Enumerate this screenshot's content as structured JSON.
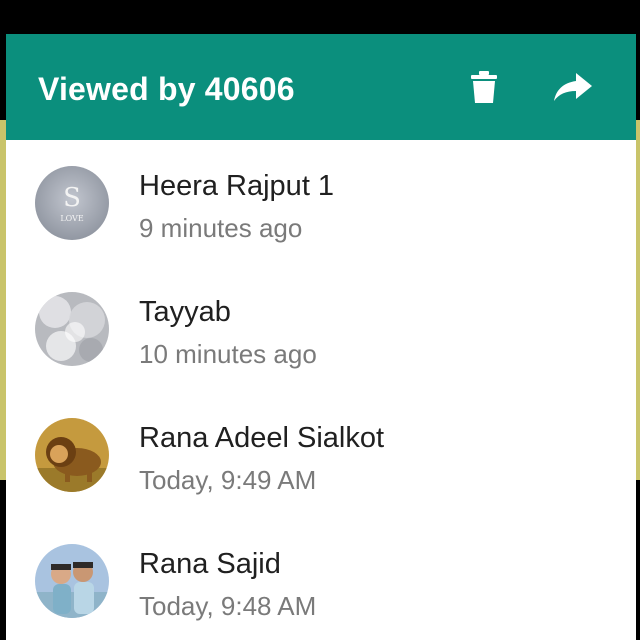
{
  "header": {
    "title": "Viewed by 40606",
    "delete_icon": "trash-icon",
    "share_icon": "forward-arrow-icon",
    "color": "#0b8f7d"
  },
  "viewers": [
    {
      "name": "Heera Rajput 1",
      "time": "9 minutes ago",
      "avatar": "avatar-s-love"
    },
    {
      "name": "Tayyab",
      "time": "10 minutes ago",
      "avatar": "avatar-bokeh"
    },
    {
      "name": "Rana Adeel Sialkot",
      "time": "Today, 9:49 AM",
      "avatar": "avatar-lion"
    },
    {
      "name": "Rana Sajid",
      "time": "Today, 9:48 AM",
      "avatar": "avatar-two-people"
    }
  ]
}
